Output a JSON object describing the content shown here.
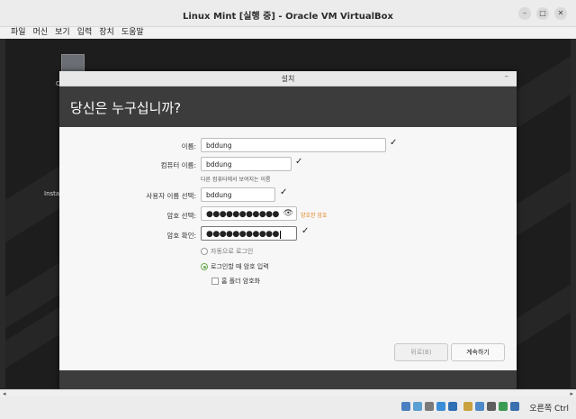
{
  "window": {
    "title": "Linux Mint [실행 중] - Oracle VM VirtualBox",
    "minimize_glyph": "–",
    "maximize_glyph": "□",
    "close_glyph": "✕"
  },
  "menu": [
    "파일",
    "머신",
    "보기",
    "입력",
    "장치",
    "도움말"
  ],
  "desktop": {
    "icon1_label": "C",
    "icon2_label": "Insta"
  },
  "dialog": {
    "title": "설치",
    "minimize_glyph": "–",
    "heading": "당신은 누구십니까?",
    "name": {
      "label": "이름:",
      "value": "bddung"
    },
    "computer": {
      "label": "컴퓨터 이름:",
      "value": "bddung",
      "hint": "다른 컴퓨터에서 보여지는 이름"
    },
    "username": {
      "label": "사용자 이름 선택:",
      "value": "bddung"
    },
    "password": {
      "label": "암호 선택:",
      "value": "●●●●●●●●●●●",
      "strength": "양호한 암호"
    },
    "confirm": {
      "label": "암호 확인:",
      "value": "●●●●●●●●●●●"
    },
    "auto_login": "자동으로 로그인",
    "require_password": "로그인할 때 암호 입력",
    "encrypt_home": "홈 폴더 암호화",
    "check_glyph": "✓",
    "back_button": "뒤로(B)",
    "continue_button": "계속하기"
  },
  "statusbar": {
    "host_key": "오른쪽 Ctrl"
  },
  "icons": {
    "status": [
      "hdd-icon",
      "optical-icon",
      "audio-icon",
      "network-icon",
      "usb-icon",
      "shared-folder-icon",
      "display-icon",
      "recording-icon",
      "cpu-icon",
      "mouse-integration-icon",
      "keyboard-icon",
      "arrow-icon"
    ]
  }
}
